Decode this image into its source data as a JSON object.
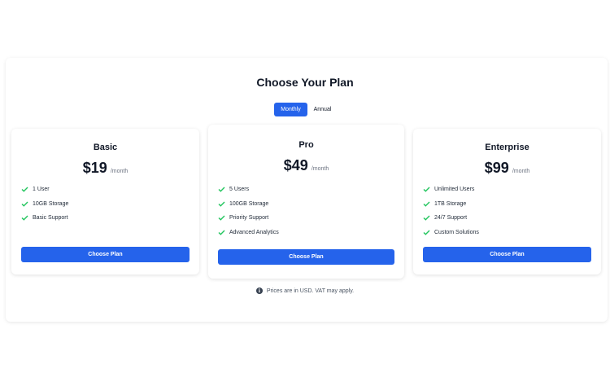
{
  "page": {
    "title": "Choose Your Plan",
    "billing_toggle": {
      "monthly": "Monthly",
      "annual": "Annual",
      "selected": "Monthly"
    },
    "footnote": "Prices are in USD. VAT may apply."
  },
  "plans": [
    {
      "name": "Basic",
      "price": "$19",
      "period": "/month",
      "features": [
        "1 User",
        "10GB Storage",
        "Basic Support"
      ],
      "cta": "Choose Plan"
    },
    {
      "name": "Pro",
      "price": "$49",
      "period": "/month",
      "features": [
        "5 Users",
        "100GB Storage",
        "Priority Support",
        "Advanced Analytics"
      ],
      "cta": "Choose Plan"
    },
    {
      "name": "Enterprise",
      "price": "$99",
      "period": "/month",
      "features": [
        "Unlimited Users",
        "1TB Storage",
        "24/7 Support",
        "Custom Solutions"
      ],
      "cta": "Choose Plan"
    }
  ],
  "colors": {
    "accent": "#2563eb",
    "check": "#22c55e",
    "text": "#111827",
    "muted": "#6b7280"
  },
  "icons": {
    "feature": "check-icon",
    "footnote": "info-icon"
  }
}
